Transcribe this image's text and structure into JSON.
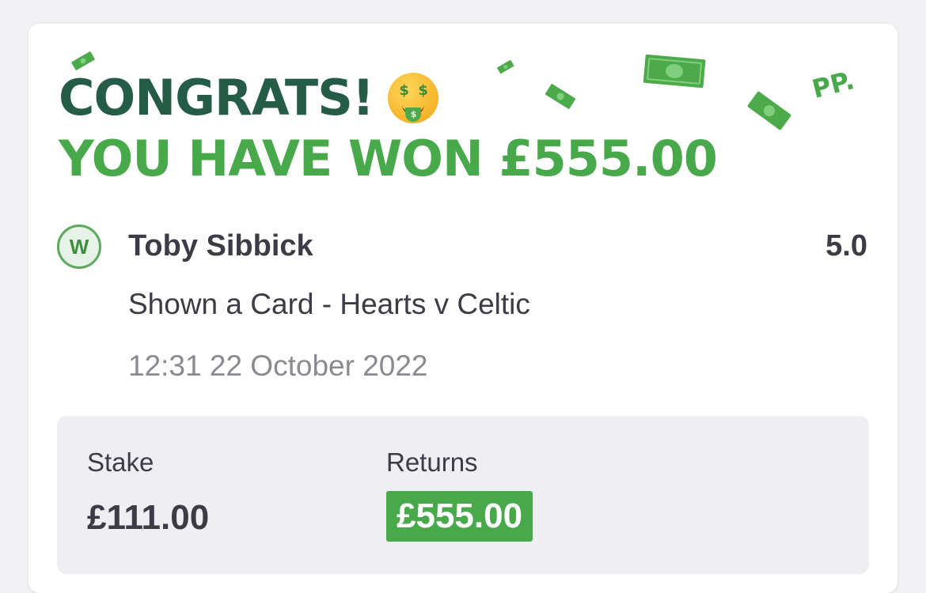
{
  "congrats": {
    "headline": "CONGRATS!",
    "emoji": "money-mouth-face-emoji",
    "won_text": "YOU HAVE WON £555.00",
    "brand_mark": "PP."
  },
  "selection": {
    "badge": "W",
    "name": "Toby Sibbick",
    "odds": "5.0",
    "market": "Shown a Card - Hearts v Celtic",
    "datetime": "12:31 22 October 2022"
  },
  "summary": {
    "stake_label": "Stake",
    "stake_value": "£111.00",
    "returns_label": "Returns",
    "returns_value": "£555.00"
  },
  "colors": {
    "dark_green": "#245c47",
    "bright_green": "#47a94a",
    "text": "#3c3c46",
    "muted": "#8a8a92",
    "panel": "#efeff3"
  }
}
